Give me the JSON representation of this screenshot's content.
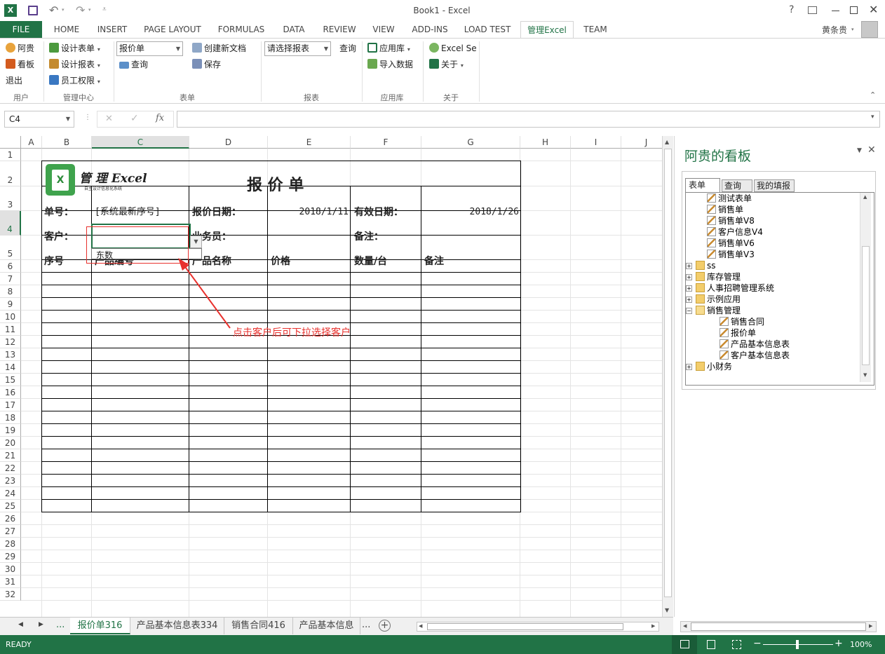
{
  "title": {
    "app_title": "Book1 - Excel",
    "user": "黄条贵",
    "help": "?"
  },
  "tabs": {
    "file": "FILE",
    "home": "HOME",
    "insert": "INSERT",
    "page_layout": "PAGE LAYOUT",
    "formulas": "FORMULAS",
    "data": "DATA",
    "review": "REVIEW",
    "view": "VIEW",
    "addins": "ADD-INS",
    "load_test": "LOAD TEST",
    "custom": "管理Excel",
    "team": "TEAM"
  },
  "ribbon": {
    "user_group": {
      "name": "用户",
      "agui": "阿贵",
      "board": "看板",
      "logout": "退出"
    },
    "mgmt_group": {
      "name": "管理中心",
      "design_form": "设计表单",
      "design_report": "设计报表",
      "staff_perm": "员工权限"
    },
    "form_group": {
      "name": "表单",
      "form_select": "报价单",
      "query": "查询",
      "new_doc": "创建新文档",
      "save": "保存"
    },
    "report_group": {
      "name": "报表",
      "report_select": "请选择报表",
      "query": "查询"
    },
    "app_group": {
      "name": "应用库",
      "app_lib": "应用库",
      "import": "导入数据"
    },
    "about_group": {
      "name": "关于",
      "excel_se": "Excel Se",
      "about": "关于"
    }
  },
  "formula": {
    "name_box": "C4",
    "cancel": "✕",
    "enter": "✓",
    "fx": "fx",
    "value": ""
  },
  "columns": [
    "A",
    "B",
    "C",
    "D",
    "E",
    "F",
    "G",
    "H",
    "I",
    "J"
  ],
  "rows": [
    "1",
    "2",
    "3",
    "4",
    "5",
    "6",
    "7",
    "8",
    "9",
    "10",
    "11",
    "12",
    "13",
    "14",
    "15",
    "16",
    "17",
    "18",
    "19",
    "20",
    "21",
    "22",
    "23",
    "24",
    "25",
    "26",
    "27",
    "28",
    "29",
    "30",
    "31",
    "32"
  ],
  "form": {
    "logo_text": "管 理 Excel",
    "logo_sub": "自主设计信息化系统",
    "logo_letter": "X",
    "title": "报 价 单",
    "no_label": "单号：",
    "no_value": "[系统最新序号]",
    "quote_date_label": "报价日期：",
    "quote_date": "2018/1/11",
    "valid_date_label": "有效日期：",
    "valid_date": "2018/1/26",
    "customer_label": "客户：",
    "salesman_label": "业务员：",
    "note_label": "备注：",
    "headers": [
      "序号",
      "产品编号",
      "产品名称",
      "价格",
      "数量/台",
      "备注"
    ],
    "dropdown_option": "东数",
    "annotation": "点击客户后可下拉选择客户"
  },
  "pane": {
    "title": "阿贵的看板",
    "tabs": [
      "表单",
      "查询",
      "我的填报"
    ],
    "tree": [
      {
        "label": "测试表单",
        "level": 1,
        "type": "form"
      },
      {
        "label": "销售单",
        "level": 1,
        "type": "form"
      },
      {
        "label": "销售单V8",
        "level": 1,
        "type": "form"
      },
      {
        "label": "客户信息V4",
        "level": 1,
        "type": "form"
      },
      {
        "label": "销售单V6",
        "level": 1,
        "type": "form"
      },
      {
        "label": "销售单V3",
        "level": 1,
        "type": "form"
      },
      {
        "label": "ss",
        "level": 0,
        "type": "folder"
      },
      {
        "label": "库存管理",
        "level": 0,
        "type": "folder"
      },
      {
        "label": "人事招聘管理系统",
        "level": 0,
        "type": "folder"
      },
      {
        "label": "示例应用",
        "level": 0,
        "type": "folder"
      },
      {
        "label": "销售管理",
        "level": 0,
        "type": "folder-open"
      },
      {
        "label": "销售合同",
        "level": 2,
        "type": "form"
      },
      {
        "label": "报价单",
        "level": 2,
        "type": "form"
      },
      {
        "label": "产品基本信息表",
        "level": 2,
        "type": "form"
      },
      {
        "label": "客户基本信息表",
        "level": 2,
        "type": "form"
      },
      {
        "label": "小财务",
        "level": 0,
        "type": "folder"
      }
    ]
  },
  "sheet_tabs": {
    "more_left": "...",
    "active": "报价单316",
    "tab2": "产品基本信息表334",
    "tab3": "销售合同416",
    "tab4": "产品基本信息",
    "more_right": "..."
  },
  "status": {
    "ready": "READY",
    "zoom": "100%",
    "minus": "−",
    "plus": "+"
  },
  "colors": {
    "excel_green": "#217346",
    "annotation_red": "#e8312d",
    "logo_green": "#3fa34d"
  }
}
